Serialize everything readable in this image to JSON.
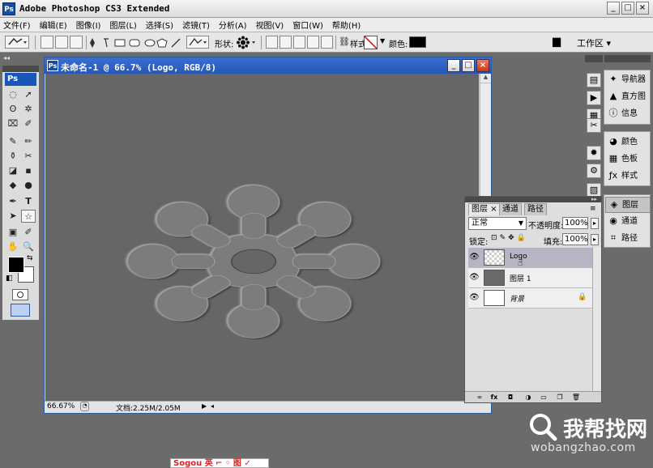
{
  "app": {
    "title": "Adobe Photoshop CS3 Extended",
    "logo": "Ps",
    "window_buttons": [
      "_",
      "□",
      "×"
    ]
  },
  "menu": [
    "文件(F)",
    "编辑(E)",
    "图像(I)",
    "图层(L)",
    "选择(S)",
    "滤镜(T)",
    "分析(A)",
    "视图(V)",
    "窗口(W)",
    "帮助(H)"
  ],
  "options": {
    "shape_label": "形状:",
    "style_label": "样式:",
    "color_label": "颜色:",
    "workspace": "工作区 ▾",
    "color_value": "#000000"
  },
  "tools": {
    "badge": "Ps",
    "glyphs": [
      "◌",
      "➚",
      "ʘ",
      "✲",
      "⌧",
      "✐",
      "✎",
      "✏",
      "⚱",
      "✂",
      "◪",
      "▪",
      "◆",
      "●",
      "✒",
      "T",
      "➤",
      "☆",
      "▣",
      "✐",
      "✋",
      "🔍"
    ]
  },
  "document": {
    "title": "未命名-1 @ 66.7% (Logo, RGB/8)",
    "zoom": "66.67%",
    "docsize": "文档:2.25M/2.05M"
  },
  "dock": {
    "top": [
      "导航器",
      "直方图",
      "信息"
    ],
    "middle": [
      "颜色",
      "色板",
      "样式"
    ],
    "bottom": [
      "图层",
      "通道",
      "路径"
    ]
  },
  "layers": {
    "tabs": [
      "图层 ×",
      "通道",
      "路径"
    ],
    "blend_mode": "正常",
    "opacity_label": "不透明度:",
    "opacity": "100%",
    "lock_label": "锁定:",
    "fill_label": "填充:",
    "fill": "100%",
    "rows": [
      {
        "name": "Logo",
        "selected": true
      },
      {
        "name": "图层 1",
        "selected": false
      },
      {
        "name": "背景",
        "selected": false
      }
    ]
  },
  "watermark": {
    "text": "我帮找网",
    "url": "wobangzhao.com"
  },
  "taskbar": {
    "chip": "Sogou 英 ⌐ ◦ 图 ✓"
  }
}
